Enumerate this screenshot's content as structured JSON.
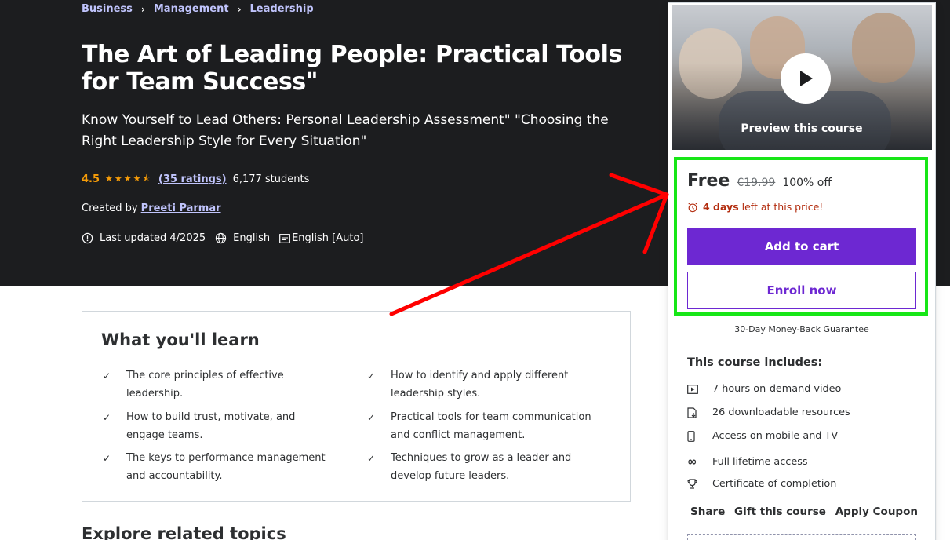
{
  "breadcrumb": [
    {
      "label": "Business"
    },
    {
      "label": "Management"
    },
    {
      "label": "Leadership"
    }
  ],
  "course": {
    "title": "The Art of Leading People: Practical Tools for Team Success\"",
    "subtitle": "Know Yourself to Lead Others: Personal Leadership Assessment\" \"Choosing the Right Leadership Style for Every Situation\"",
    "rating": "4.5",
    "rating_stars": 4.5,
    "ratings_count": "(35 ratings)",
    "students": "6,177 students",
    "created_by_label": "Created by",
    "author": "Preeti Parmar",
    "last_updated": "Last updated 4/2025",
    "language": "English",
    "captions": "English [Auto]"
  },
  "learn": {
    "heading": "What you'll learn",
    "items": [
      "The core principles of effective leadership.",
      "How to identify and apply different leadership styles.",
      "How to build trust, motivate, and engage teams.",
      "Practical tools for team communication and conflict management.",
      "The keys to performance management and accountability.",
      "Techniques to grow as a leader and develop future leaders."
    ]
  },
  "related": {
    "heading": "Explore related topics"
  },
  "sidebar": {
    "preview_label": "Preview this course",
    "price": "Free",
    "original_price": "€19.99",
    "discount": "100% off",
    "timer_bold": "4 days",
    "timer_text": "left at this price!",
    "add_to_cart": "Add to cart",
    "enroll_now": "Enroll now",
    "guarantee": "30-Day Money-Back Guarantee",
    "includes_title": "This course includes:",
    "includes": [
      {
        "icon": "video-icon",
        "label": "7 hours on-demand video"
      },
      {
        "icon": "file-download-icon",
        "label": "26 downloadable resources"
      },
      {
        "icon": "mobile-icon",
        "label": "Access on mobile and TV"
      },
      {
        "icon": "infinity-icon",
        "label": "Full lifetime access"
      },
      {
        "icon": "trophy-icon",
        "label": "Certificate of completion"
      }
    ],
    "share": "Share",
    "gift": "Gift this course",
    "coupon": "Apply Coupon"
  },
  "colors": {
    "hero_bg": "#1c1d1f",
    "link_purple": "#c0c4fc",
    "star": "#f69c08",
    "primary": "#6d28d2",
    "timer_red": "#b32d0f",
    "highlight_green": "#17e617",
    "arrow_red": "#ff0000"
  }
}
